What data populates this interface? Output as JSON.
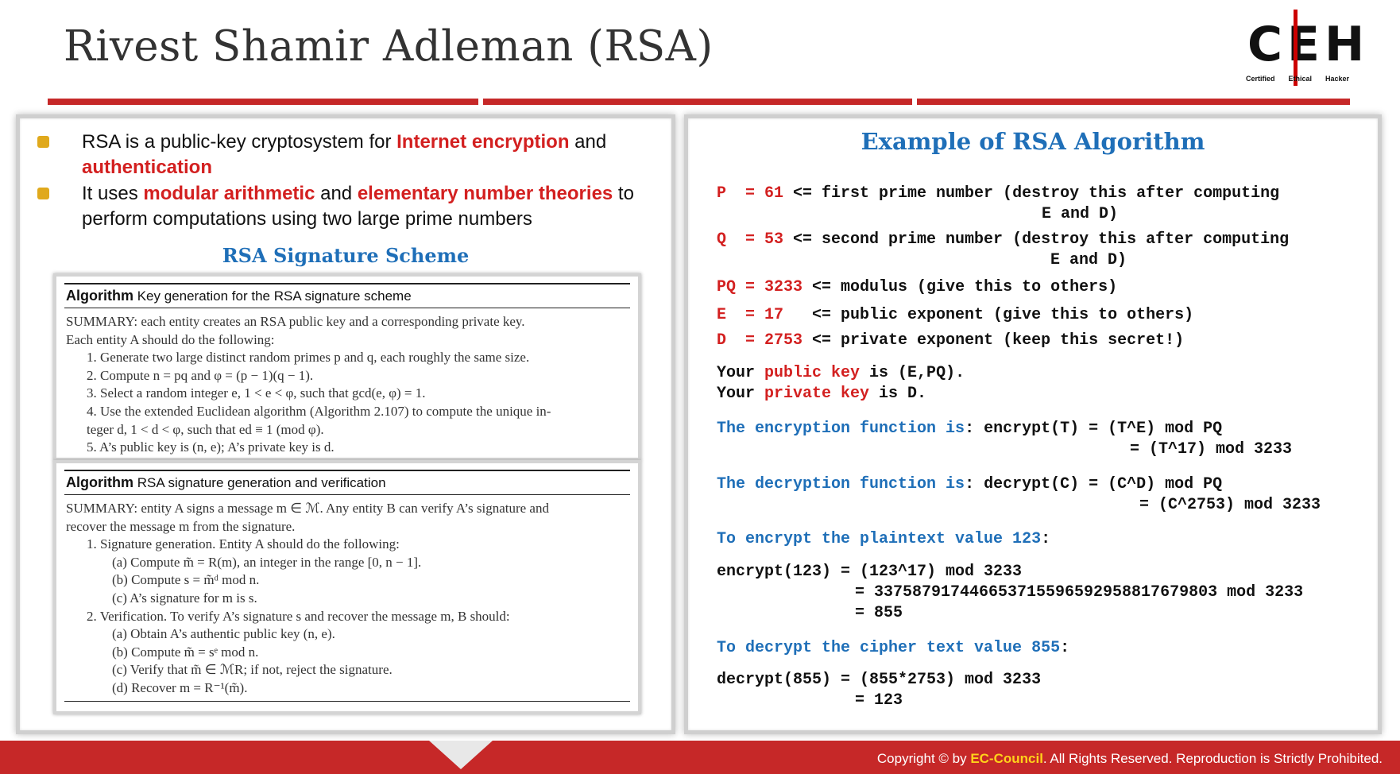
{
  "title": "Rivest Shamir Adleman (RSA)",
  "logo": {
    "letters": "CEH",
    "words": [
      "Certified",
      "Ethical",
      "Hacker"
    ]
  },
  "colors": {
    "accent_red": "#c62828",
    "heading_blue": "#1f6fb8",
    "bullet_gold": "#e0a91c"
  },
  "left": {
    "bullet1": {
      "t1": "RSA is a public-key cryptosystem for ",
      "h1": "Internet encryption",
      "t2": " and",
      "h2": "authentication"
    },
    "bullet2": {
      "t1": "It uses ",
      "h1": "modular arithmetic",
      "t2": " and ",
      "h2": "elementary number theories",
      "t3": " to",
      "t4": "perform computations using two large prime numbers"
    },
    "scheme_title": "RSA Signature Scheme",
    "algo1": {
      "head_bold": "Algorithm",
      "head_text": " Key generation for the RSA signature scheme",
      "lines": [
        "SUMMARY: each entity creates an RSA public key and a corresponding private key.",
        "Each entity A should do the following:",
        "1.  Generate two large distinct random primes p and q, each roughly the same size.",
        "2.  Compute n = pq and φ = (p − 1)(q − 1).",
        "3.  Select a random integer e, 1 < e < φ, such that gcd(e, φ) = 1.",
        "4.  Use the extended Euclidean algorithm (Algorithm 2.107) to compute the unique in-",
        "     teger d, 1 < d < φ, such that ed ≡ 1  (mod φ).",
        "5.  A’s public key is (n, e); A’s private key is d."
      ]
    },
    "algo2": {
      "head_bold": "Algorithm",
      "head_text": " RSA signature generation and verification",
      "lines": [
        "SUMMARY: entity A signs a message m ∈ ℳ. Any entity B can verify A’s signature and",
        "recover the message m from the signature.",
        "1.  Signature generation. Entity A should do the following:",
        "(a)  Compute m̃ = R(m), an integer in the range [0, n − 1].",
        "(b)  Compute s = m̃ᵈ mod n.",
        "(c)  A’s signature for m is s.",
        "2.  Verification. To verify A’s signature s and recover the message m, B should:",
        "(a)  Obtain A’s authentic public key (n, e).",
        "(b)  Compute m̃ = sᵉ mod n.",
        "(c)  Verify that m̃ ∈ ℳR; if not, reject the signature.",
        "(d)  Recover m = R⁻¹(m̃)."
      ]
    }
  },
  "right": {
    "title": "Example of RSA Algorithm",
    "p": {
      "label": "P  = 61",
      "text": " <= first prime number (destroy this after computing",
      "cont": "E and D)"
    },
    "q": {
      "label": "Q  = 53",
      "text": " <= second prime number (destroy this after computing",
      "cont": "E and D)"
    },
    "pq": {
      "label": "PQ = 3233",
      "text": " <= modulus (give this to others)"
    },
    "e": {
      "label": "E  = 17",
      "text": "   <= public exponent (give this to others)"
    },
    "d": {
      "label": "D  = 2753",
      "text": " <= private exponent (keep this secret!)"
    },
    "pub": {
      "a": "Your ",
      "b": "public key",
      "c": " is (E,PQ)."
    },
    "priv": {
      "a": "Your ",
      "b": "private key",
      "c": " is D."
    },
    "enc_fn": {
      "label": "The encryption function is",
      "text": ": encrypt(T) = (T^E) mod PQ",
      "cont": "= (T^17) mod 3233"
    },
    "dec_fn": {
      "label": "The decryption function is",
      "text": ": decrypt(C) = (C^D) mod PQ",
      "cont": "= (C^2753) mod 3233"
    },
    "enc_head": {
      "label": "To encrypt the plaintext value 123",
      "colon": ":"
    },
    "enc_lines": [
      "encrypt(123) = (123^17) mod 3233",
      "= 337587917446653715596592958817679803 mod 3233",
      "= 855"
    ],
    "dec_head": {
      "label": "To decrypt the cipher text value 855",
      "colon": ":"
    },
    "dec_lines": [
      "decrypt(855) = (855*2753) mod 3233",
      "= 123"
    ]
  },
  "footer": {
    "pre": "Copyright  © by ",
    "brand": "EC-Council",
    "post": ". All Rights Reserved. Reproduction  is Strictly Prohibited."
  }
}
